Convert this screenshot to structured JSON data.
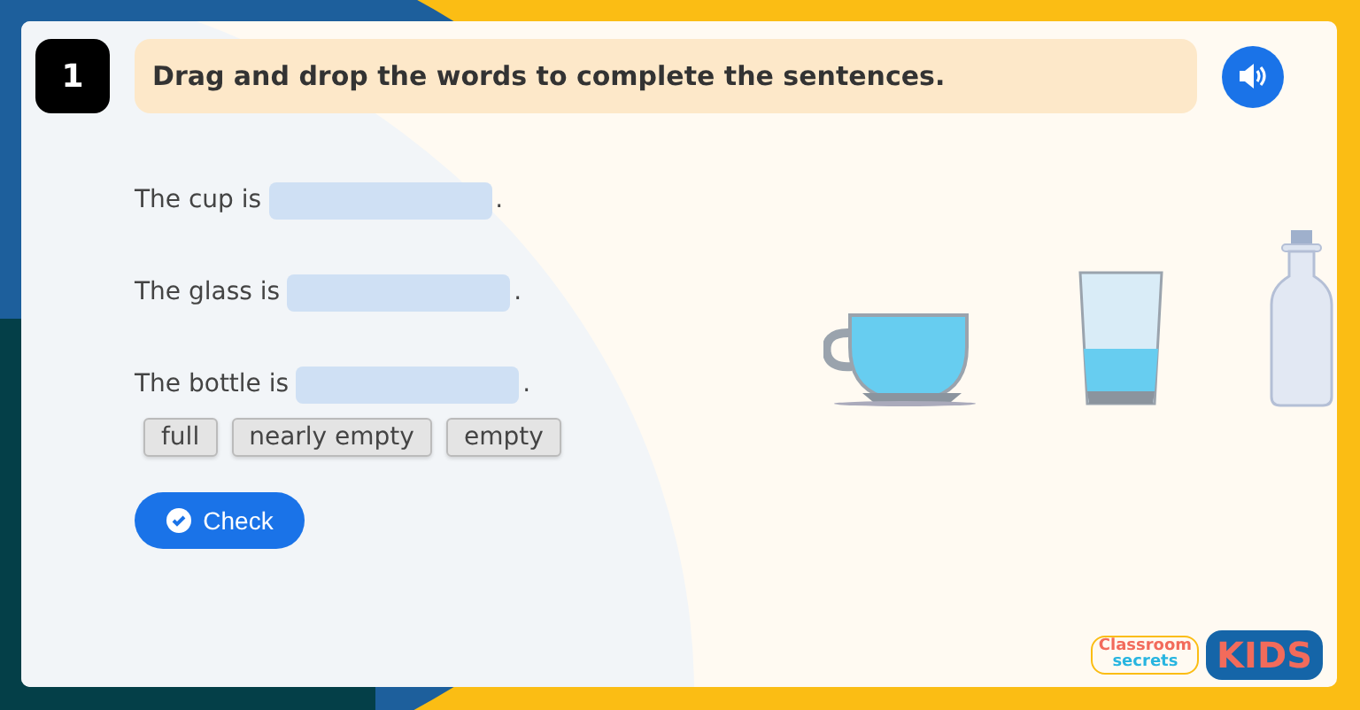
{
  "question": {
    "number": "1",
    "instruction": "Drag and drop the words to complete the sentences."
  },
  "sentences": [
    {
      "before": "The cup is",
      "after": "."
    },
    {
      "before": "The glass is",
      "after": "."
    },
    {
      "before": "The bottle is",
      "after": "."
    }
  ],
  "words": [
    "full",
    "nearly empty",
    "empty"
  ],
  "check_button": "Check",
  "logo": {
    "brand_top": "Classroom",
    "brand_bottom": "secrets",
    "badge": "KIDS"
  }
}
